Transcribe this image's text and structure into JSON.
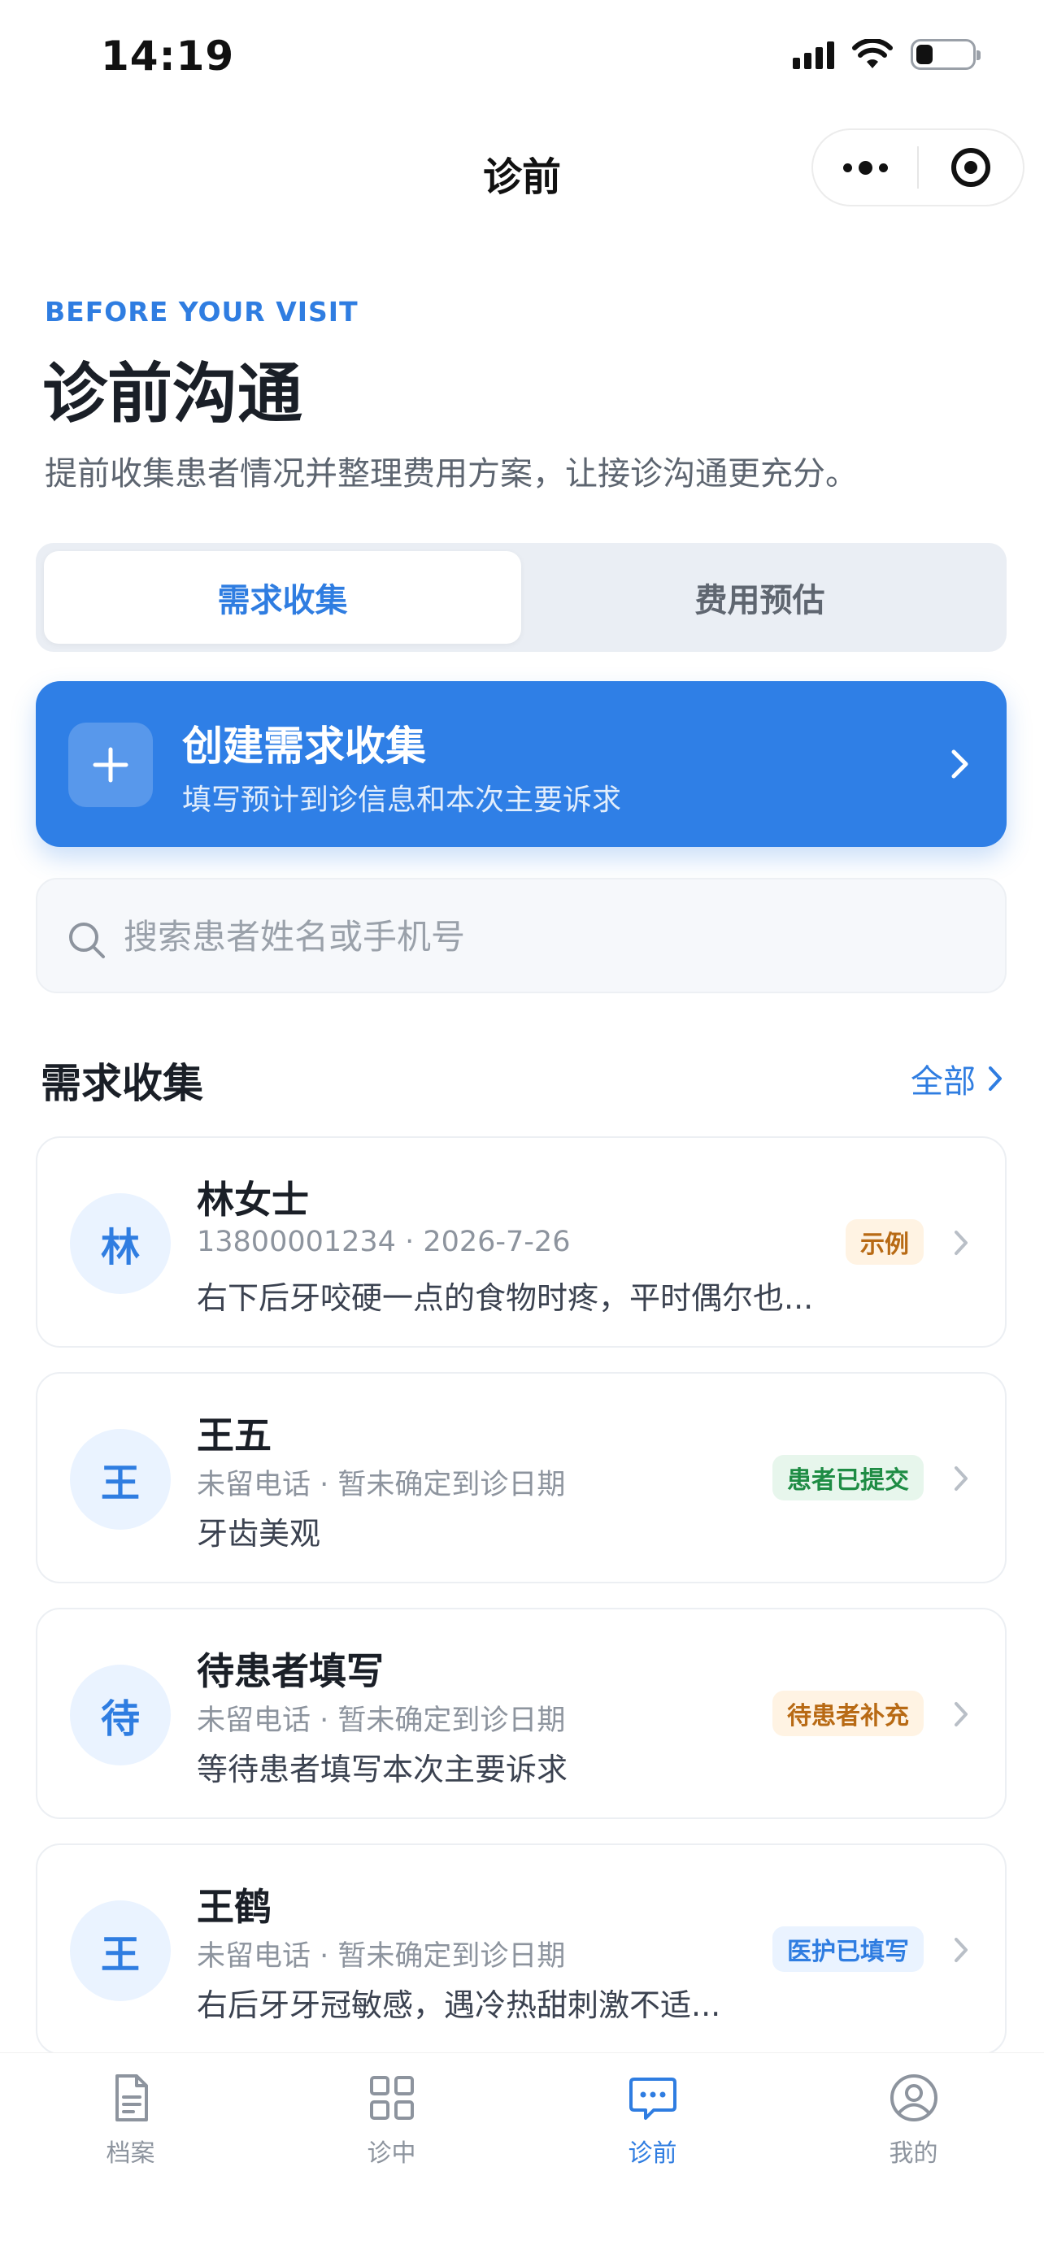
{
  "status_bar": {
    "time": "14:19"
  },
  "nav": {
    "title": "诊前"
  },
  "header": {
    "eyebrow": "BEFORE YOUR VISIT",
    "title": "诊前沟通",
    "subtitle": "提前收集患者情况并整理费用方案，让接诊沟通更充分。"
  },
  "segments": [
    {
      "label": "需求收集",
      "active": true
    },
    {
      "label": "费用预估",
      "active": false
    }
  ],
  "create_banner": {
    "title": "创建需求收集",
    "subtitle": "填写预计到诊信息和本次主要诉求"
  },
  "search": {
    "placeholder": "搜索患者姓名或手机号",
    "value": ""
  },
  "section": {
    "title": "需求收集",
    "all_label": "全部"
  },
  "records": [
    {
      "avatar": "林",
      "name": "林女士",
      "meta": "13800001234 · 2026-7-26",
      "desc": "右下后牙咬硬一点的食物时疼，平时偶尔也...",
      "badge": "示例",
      "badge_color": "#b86a14"
    },
    {
      "avatar": "王",
      "name": "王五",
      "meta": "未留电话 · 暂未确定到诊日期",
      "desc": "牙齿美观",
      "badge": "患者已提交",
      "badge_color": "#1e8c44"
    },
    {
      "avatar": "待",
      "name": "待患者填写",
      "meta": "未留电话 · 暂未确定到诊日期",
      "desc": "等待患者填写本次主要诉求",
      "badge": "待患者补充",
      "badge_color": "#b86a14"
    },
    {
      "avatar": "王",
      "name": "王鹤",
      "meta": "未留电话 · 暂未确定到诊日期",
      "desc": "右后牙牙冠敏感，遇冷热甜刺激不适...",
      "badge": "医护已填写",
      "badge_color": "#2f7de1"
    }
  ],
  "tabbar": [
    {
      "label": "档案",
      "icon": "document-icon",
      "active": false
    },
    {
      "label": "诊中",
      "icon": "grid-icon",
      "active": false
    },
    {
      "label": "诊前",
      "icon": "chat-icon",
      "active": true
    },
    {
      "label": "我的",
      "icon": "user-icon",
      "active": false
    }
  ],
  "colors": {
    "accent": "#2f7de1",
    "banner": "#2f7fe6"
  }
}
